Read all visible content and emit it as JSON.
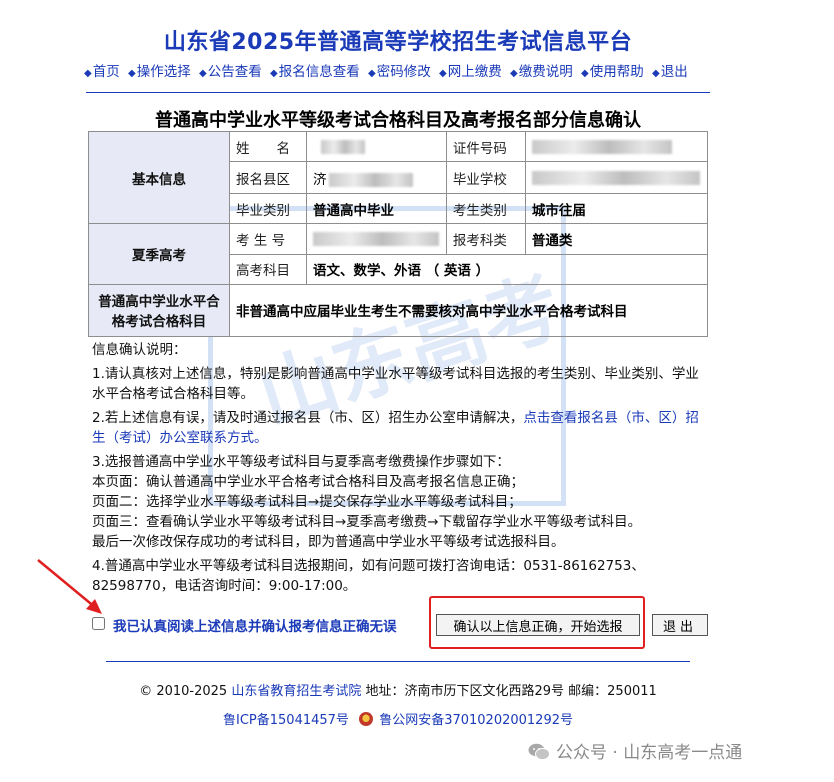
{
  "site_title": "山东省2025年普通高等学校招生考试信息平台",
  "nav": [
    {
      "label": "首页"
    },
    {
      "label": "操作选择"
    },
    {
      "label": "公告查看"
    },
    {
      "label": "报名信息查看"
    },
    {
      "label": "密码修改"
    },
    {
      "label": "网上缴费"
    },
    {
      "label": "缴费说明"
    },
    {
      "label": "使用帮助"
    },
    {
      "label": "退出"
    }
  ],
  "form_title": "普通高中学业水平等级考试合格科目及高考报名部分信息确认",
  "table": {
    "basic_section": "基本信息",
    "name_label": "姓　　名",
    "id_label": "证件号码",
    "county_label": "报名县区",
    "county_value_prefix": "济",
    "school_label": "毕业学校",
    "grad_type_label": "毕业类别",
    "grad_type_value": "普通高中毕业",
    "candidate_type_label": "考生类别",
    "candidate_type_value": "城市往届",
    "summer_section": "夏季高考",
    "exam_no_label": "考 生 号",
    "exam_category_label": "报考科类",
    "exam_category_value": "普通类",
    "subjects_label": "高考科目",
    "subjects_value": "语文、数学、外语 （ 英语 ）",
    "level_section": "普通高中学业水平合格考试合格科目",
    "level_value": "非普通高中应届毕业生考生不需要核对高中学业水平合格考试科目"
  },
  "notes": {
    "heading": "信息确认说明：",
    "item1": "1.请认真核对上述信息，特别是影响普通高中学业水平等级考试科目选报的考生类别、毕业类别、学业水平合格考试合格科目等。",
    "item2_text": "2.若上述信息有误，请及时通过报名县（市、区）招生办公室申请解决，",
    "item2_link": "点击查看报名县（市、区）招生（考试）办公室联系方式。",
    "item3_line1": "3.选报普通高中学业水平等级考试科目与夏季高考缴费操作步骤如下：",
    "item3_line2": "本页面：确认普通高中学业水平合格考试合格科目及高考报名信息正确；",
    "item3_line3": "页面二：选择学业水平等级考试科目→提交保存学业水平等级考试科目；",
    "item3_line4": "页面三：查看确认学业水平等级考试科目→夏季高考缴费→下载留存学业水平等级考试科目。",
    "item3_line5": "最后一次修改保存成功的考试科目，即为普通高中学业水平等级考试选报科目。",
    "item4": "4.普通高中学业水平等级考试科目选报期间，如有问题可拨打咨询电话：0531-86162753、82598770，电话咨询时间：9:00-17:00。"
  },
  "confirm": {
    "checkbox_label": "我已认真阅读上述信息并确认报考信息正确无误",
    "start_button": "确认以上信息正确，开始选报",
    "exit_button": "退出"
  },
  "footer": {
    "copyright": "© 2010-2025",
    "org_link": "山东省教育招生考试院",
    "address": "地址：济南市历下区文化西路29号 邮编：250011",
    "icp": "鲁ICP备15041457号",
    "police": "鲁公网安备37010202001292号"
  },
  "watermark": {
    "text": "山东高考",
    "wechat": "公众号 · 山东高考一点通"
  },
  "colors": {
    "link_blue": "#1a3ab8",
    "section_bg": "#e7eaf6",
    "highlight_red": "#e02020"
  }
}
